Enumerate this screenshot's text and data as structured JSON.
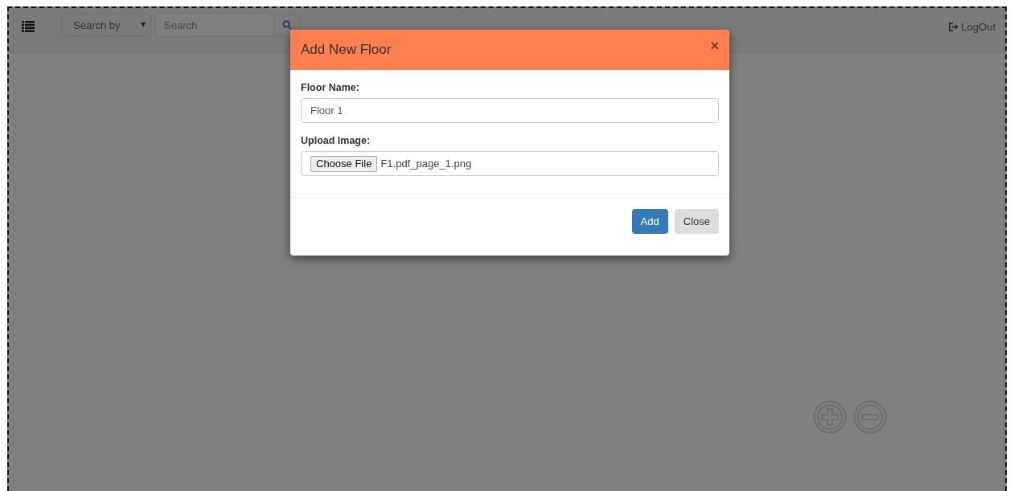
{
  "navbar": {
    "search_by": "Search by",
    "search": {
      "placeholder": "Search"
    },
    "logout": "LogOut"
  },
  "modal": {
    "title": "Add New Floor",
    "close_symbol": "×",
    "fields": [
      {
        "kind": "text",
        "label": "Floor Name:",
        "value": "Floor 1"
      },
      {
        "kind": "file",
        "label": "Upload Image:",
        "button": "Choose File",
        "value": "F1.pdf_page_1.png"
      }
    ],
    "buttons": [
      {
        "label": "Add",
        "kind": "primary"
      },
      {
        "label": "Close",
        "kind": "default"
      }
    ]
  }
}
